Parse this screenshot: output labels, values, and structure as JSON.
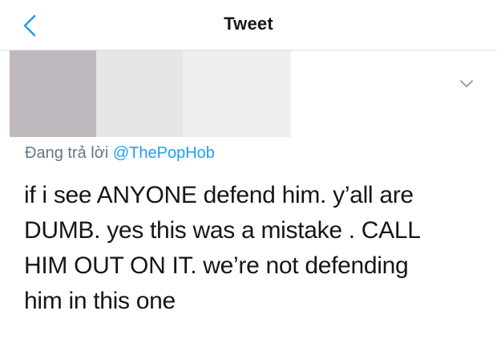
{
  "nav": {
    "title": "Tweet",
    "back_icon": "chevron-left-icon",
    "accent_color": "#1da1f2"
  },
  "tweet": {
    "menu_icon": "chevron-down-icon",
    "reply_prefix": "Đang trả lời",
    "reply_to": "@ThePopHob",
    "text_lines": [
      "if i see ANYONE defend him. y’all are",
      "DUMB. yes this was a mistake . CALL",
      "HIM OUT ON IT. we’re not defending",
      "him in this one"
    ]
  }
}
